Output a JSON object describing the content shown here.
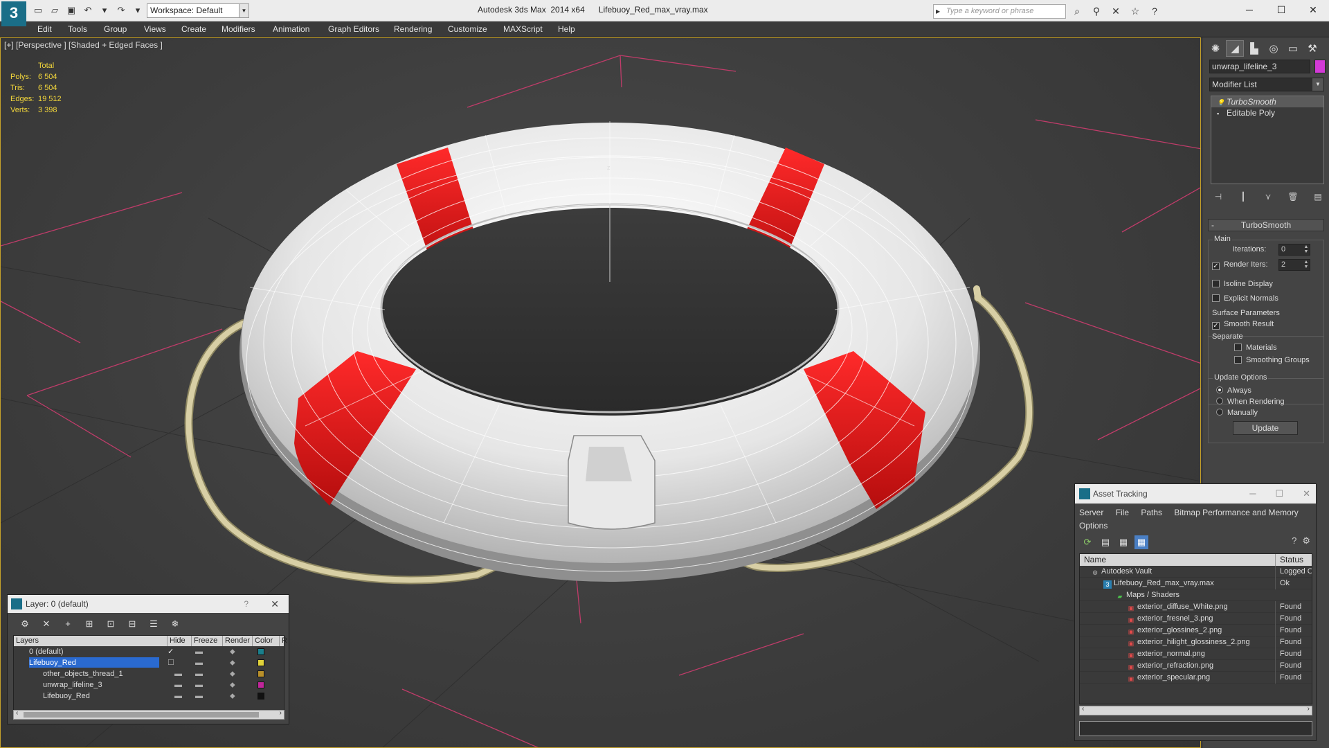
{
  "app": {
    "title": "Autodesk 3ds Max  2014 x64      Lifebuoy_Red_max_vray.max",
    "logo": "3",
    "workspace": "Workspace: Default",
    "search_placeholder": "Type a keyword or phrase"
  },
  "menu": [
    "Edit",
    "Tools",
    "Group",
    "Views",
    "Create",
    "Modifiers",
    "Animation",
    "Graph Editors",
    "Rendering",
    "Customize",
    "MAXScript",
    "Help"
  ],
  "viewport": {
    "label": "[+] [Perspective ] [Shaded + Edged Faces ]",
    "stats": {
      "header": "Total",
      "rows": [
        {
          "k": "Polys:",
          "v": "6 504"
        },
        {
          "k": "Tris:",
          "v": "6 504"
        },
        {
          "k": "Edges:",
          "v": "19 512"
        },
        {
          "k": "Verts:",
          "v": "3 398"
        }
      ]
    }
  },
  "command_panel": {
    "object_name": "unwrap_lifeline_3",
    "object_color": "#d23ad6",
    "modifier_list": "Modifier List",
    "stack": [
      "TurboSmooth",
      "Editable Poly"
    ],
    "rollout": "TurboSmooth",
    "main_group": "Main",
    "iterations_label": "Iterations:",
    "iterations_value": "0",
    "render_iters_label": "Render Iters:",
    "render_iters_value": "2",
    "isoline": "Isoline Display",
    "explicit_normals": "Explicit Normals",
    "surface_group": "Surface Parameters",
    "smooth_result": "Smooth Result",
    "separate": "Separate",
    "materials": "Materials",
    "smoothing_groups": "Smoothing Groups",
    "update_group": "Update Options",
    "always": "Always",
    "when_rendering": "When Rendering",
    "manually": "Manually",
    "update_btn": "Update"
  },
  "layer_dialog": {
    "title": "Layer: 0 (default)",
    "help": "?",
    "columns": [
      "Layers",
      "Hide",
      "Freeze",
      "Render",
      "Color",
      "R"
    ],
    "rows": [
      {
        "name": "0 (default)",
        "color": "#1a7f8c",
        "active": true,
        "indent": 1
      },
      {
        "name": "Lifebuoy_Red",
        "color": "#e0d23a",
        "selected": true,
        "indent": 1
      },
      {
        "name": "other_objects_thread_1",
        "color": "#b9902a",
        "indent": 2
      },
      {
        "name": "unwrap_lifeline_3",
        "color": "#c0269a",
        "indent": 2
      },
      {
        "name": "Lifebuoy_Red",
        "color": "#111111",
        "indent": 2
      }
    ]
  },
  "asset_tracking": {
    "title": "Asset Tracking",
    "menu": [
      "Server",
      "File",
      "Paths",
      "Bitmap Performance and Memory"
    ],
    "menu2": "Options",
    "columns": [
      "Name",
      "Status"
    ],
    "rows": [
      {
        "name": "Autodesk Vault",
        "status": "Logged Out",
        "indent": 1,
        "icon": "vault"
      },
      {
        "name": "Lifebuoy_Red_max_vray.max",
        "status": "Ok",
        "indent": 2,
        "icon": "max"
      },
      {
        "name": "Maps / Shaders",
        "status": "",
        "indent": 3,
        "icon": "maps"
      },
      {
        "name": "exterior_diffuse_White.png",
        "status": "Found",
        "indent": 4,
        "icon": "png"
      },
      {
        "name": "exterior_fresnel_3.png",
        "status": "Found",
        "indent": 4,
        "icon": "png"
      },
      {
        "name": "exterior_glossines_2.png",
        "status": "Found",
        "indent": 4,
        "icon": "png"
      },
      {
        "name": "exterior_hilight_glossiness_2.png",
        "status": "Found",
        "indent": 4,
        "icon": "png"
      },
      {
        "name": "exterior_normal.png",
        "status": "Found",
        "indent": 4,
        "icon": "png"
      },
      {
        "name": "exterior_refraction.png",
        "status": "Found",
        "indent": 4,
        "icon": "png"
      },
      {
        "name": "exterior_specular.png",
        "status": "Found",
        "indent": 4,
        "icon": "png"
      }
    ]
  },
  "colors": {
    "selection": "#c6a22a",
    "stats": "#f2d63b",
    "buoy_red": "#e21818",
    "rope": "#cfc49a"
  }
}
